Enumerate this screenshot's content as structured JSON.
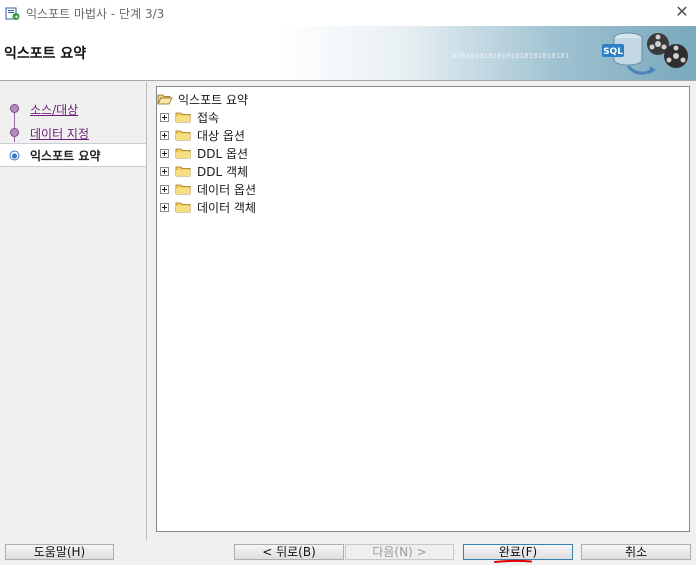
{
  "window": {
    "title": "익스포트 마법사 - 단계 3/3",
    "app_icon": "wizard-app-icon",
    "close_icon": "close-icon",
    "close_glyph": "✕"
  },
  "banner": {
    "title": "익스포트 요약",
    "binary_text": "01010101010101010101010101",
    "graphic": "sql-export-graphic"
  },
  "steps": [
    {
      "label": "소스/대상",
      "state": "visited"
    },
    {
      "label": "데이터 지정",
      "state": "visited"
    },
    {
      "label": "익스포트 요약",
      "state": "current"
    }
  ],
  "tree": {
    "root": {
      "label": "익스포트 요약",
      "icon": "open-folder-icon"
    },
    "children": [
      {
        "label": "접속",
        "icon": "folder-icon",
        "expander": "plus-box-icon"
      },
      {
        "label": "대상 옵션",
        "icon": "folder-icon",
        "expander": "plus-box-icon"
      },
      {
        "label": "DDL 옵션",
        "icon": "folder-icon",
        "expander": "plus-box-icon"
      },
      {
        "label": "DDL 객체",
        "icon": "folder-icon",
        "expander": "plus-box-icon"
      },
      {
        "label": "데이터 옵션",
        "icon": "folder-icon",
        "expander": "plus-box-icon"
      },
      {
        "label": "데이터 객체",
        "icon": "folder-icon",
        "expander": "plus-box-icon"
      }
    ]
  },
  "buttons": {
    "help": "도움말(H)",
    "back": "< 뒤로(B)",
    "next": "다음(N) >",
    "finish": "완료(F)",
    "cancel": "취소"
  },
  "colors": {
    "link_visited": "#6e1e7a",
    "annotation_red": "#e00000",
    "banner_blue": "#7aa8bd"
  }
}
